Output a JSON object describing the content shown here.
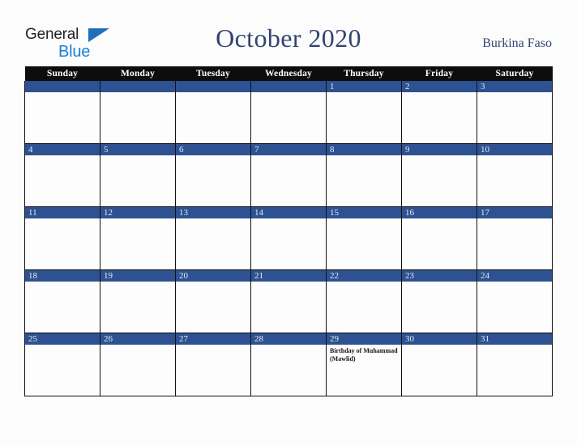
{
  "brand": {
    "name_part1": "General",
    "name_part2": "Blue",
    "color_dark": "#231f20",
    "color_blue": "#1b7fd4"
  },
  "header": {
    "title": "October 2020",
    "country": "Burkina Faso",
    "title_color": "#32456f"
  },
  "calendar": {
    "weekday_headers": [
      "Sunday",
      "Monday",
      "Tuesday",
      "Wednesday",
      "Thursday",
      "Friday",
      "Saturday"
    ],
    "header_bg": "#0d0d0d",
    "day_band_bg": "#2e5191",
    "day_number_color": "#e8ecf3",
    "weeks": [
      [
        {
          "day": "",
          "events": []
        },
        {
          "day": "",
          "events": []
        },
        {
          "day": "",
          "events": []
        },
        {
          "day": "",
          "events": []
        },
        {
          "day": "1",
          "events": []
        },
        {
          "day": "2",
          "events": []
        },
        {
          "day": "3",
          "events": []
        }
      ],
      [
        {
          "day": "4",
          "events": []
        },
        {
          "day": "5",
          "events": []
        },
        {
          "day": "6",
          "events": []
        },
        {
          "day": "7",
          "events": []
        },
        {
          "day": "8",
          "events": []
        },
        {
          "day": "9",
          "events": []
        },
        {
          "day": "10",
          "events": []
        }
      ],
      [
        {
          "day": "11",
          "events": []
        },
        {
          "day": "12",
          "events": []
        },
        {
          "day": "13",
          "events": []
        },
        {
          "day": "14",
          "events": []
        },
        {
          "day": "15",
          "events": []
        },
        {
          "day": "16",
          "events": []
        },
        {
          "day": "17",
          "events": []
        }
      ],
      [
        {
          "day": "18",
          "events": []
        },
        {
          "day": "19",
          "events": []
        },
        {
          "day": "20",
          "events": []
        },
        {
          "day": "21",
          "events": []
        },
        {
          "day": "22",
          "events": []
        },
        {
          "day": "23",
          "events": []
        },
        {
          "day": "24",
          "events": []
        }
      ],
      [
        {
          "day": "25",
          "events": []
        },
        {
          "day": "26",
          "events": []
        },
        {
          "day": "27",
          "events": []
        },
        {
          "day": "28",
          "events": []
        },
        {
          "day": "29",
          "events": [
            "Birthday of Muhammad (Mawlid)"
          ]
        },
        {
          "day": "30",
          "events": []
        },
        {
          "day": "31",
          "events": []
        }
      ]
    ]
  }
}
